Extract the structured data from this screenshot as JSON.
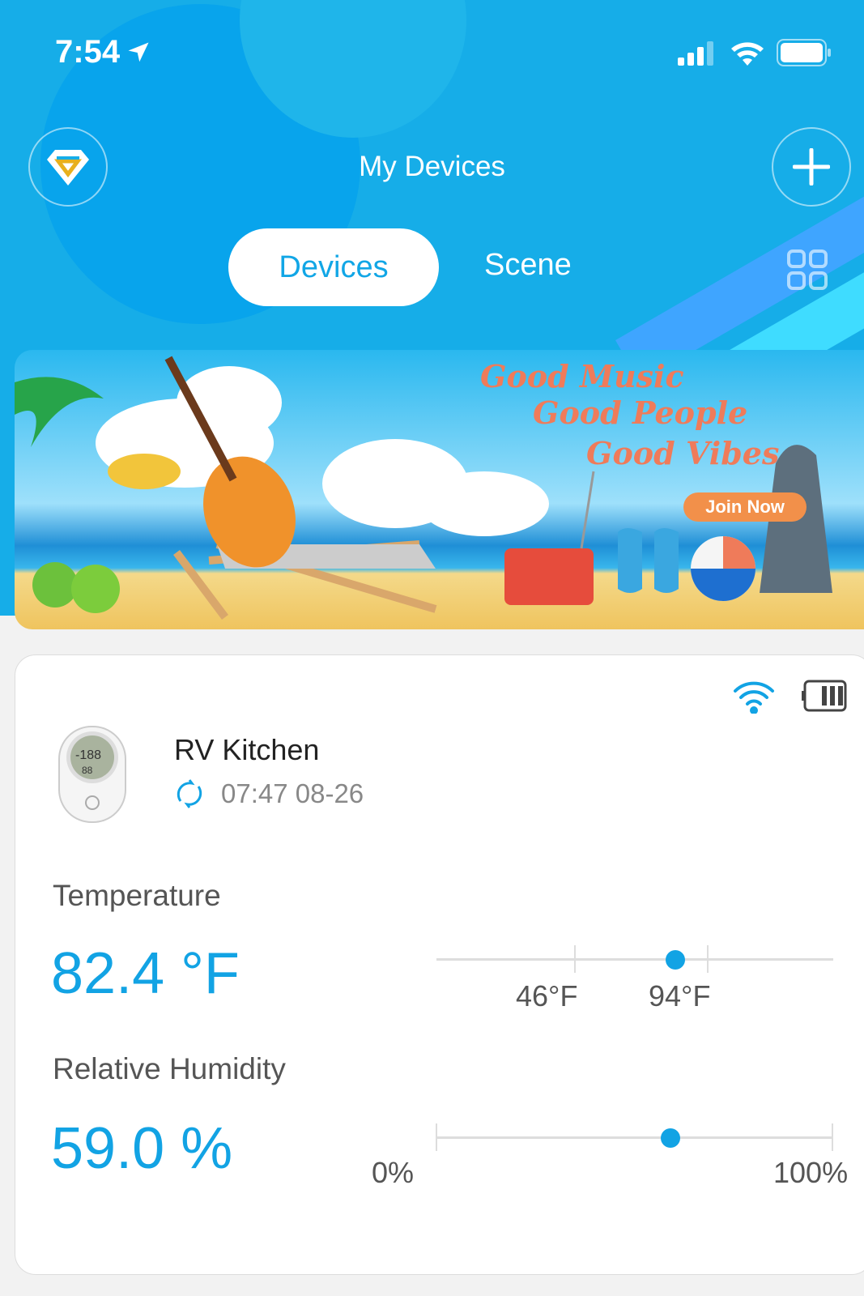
{
  "status_bar": {
    "time": "7:54",
    "location_icon": "location-arrow-icon",
    "signal_icon": "cellular-signal-icon",
    "wifi_icon": "wifi-icon",
    "battery_icon": "battery-icon"
  },
  "header": {
    "title": "My Devices",
    "left_button_icon": "diamond-icon",
    "right_button_icon": "plus-icon",
    "grid_icon": "grid-view-icon"
  },
  "tabs": [
    {
      "label": "Devices",
      "active": true
    },
    {
      "label": "Scene",
      "active": false
    }
  ],
  "banner": {
    "lines": [
      "Good Music",
      "Good People",
      "Good Vibes"
    ],
    "cta": "Join Now"
  },
  "device": {
    "name": "RV Kitchen",
    "last_sync": "07:47 08-26",
    "connection": "wifi",
    "battery_level": "full",
    "temperature": {
      "label": "Temperature",
      "value": "82.4 °F",
      "reading": 82.4,
      "min_label": "46°F",
      "max_label": "94°F",
      "min": 46,
      "max": 94
    },
    "humidity": {
      "label": "Relative Humidity",
      "value": "59.0 %",
      "reading": 59.0,
      "min_label": "0%",
      "max_label": "100%",
      "min": 0,
      "max": 100
    }
  },
  "colors": {
    "primary": "#12a3e4",
    "header": "#16ade8",
    "banner_text": "#ef7b5a",
    "cta": "#f2904a"
  }
}
